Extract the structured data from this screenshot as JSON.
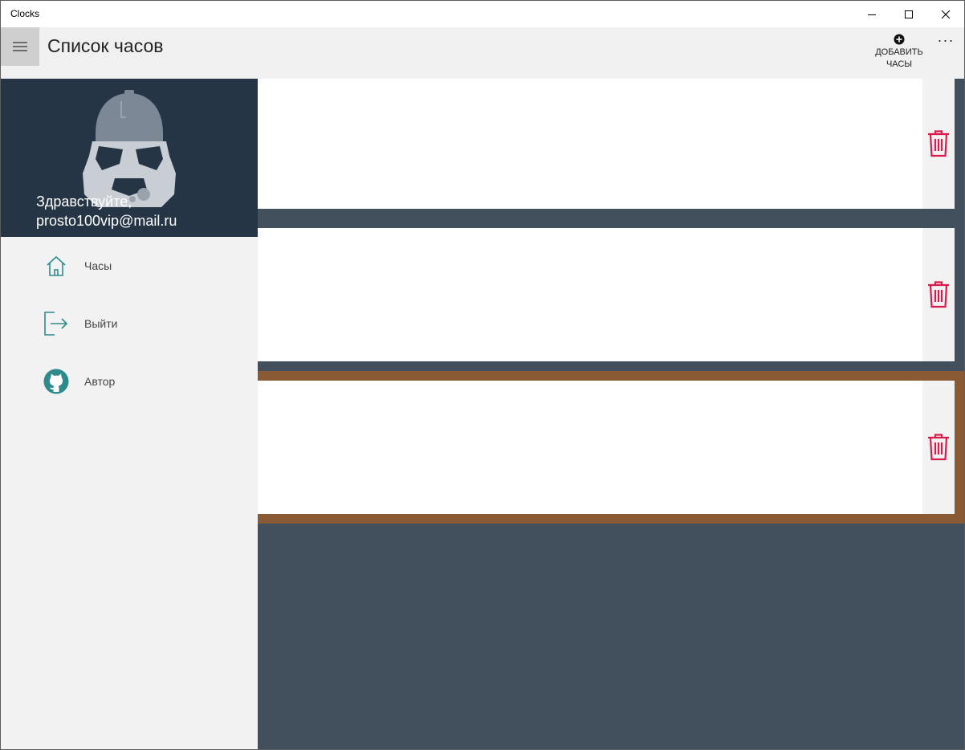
{
  "window": {
    "title": "Clocks"
  },
  "commandbar": {
    "page_title": "Список часов",
    "add_button_label": "ДОБАВИТЬ\nЧАСЫ",
    "more_label": "···"
  },
  "pane": {
    "greeting_line1": "Здравствуйте,",
    "greeting_line2": "prosto100vip@mail.ru",
    "nav": [
      {
        "label": "Часы",
        "icon": "home-icon"
      },
      {
        "label": "Выйти",
        "icon": "sign-out-icon"
      },
      {
        "label": "Автор",
        "icon": "github-icon"
      }
    ]
  },
  "clocks": {
    "count": 3,
    "selected_index": 2
  },
  "colors": {
    "accent_icon": "#2e8b8b",
    "delete_icon": "#d81b4c",
    "pane_header": "#263545",
    "content_bg": "#424f5c",
    "selection_frame": "#8a5a35"
  }
}
